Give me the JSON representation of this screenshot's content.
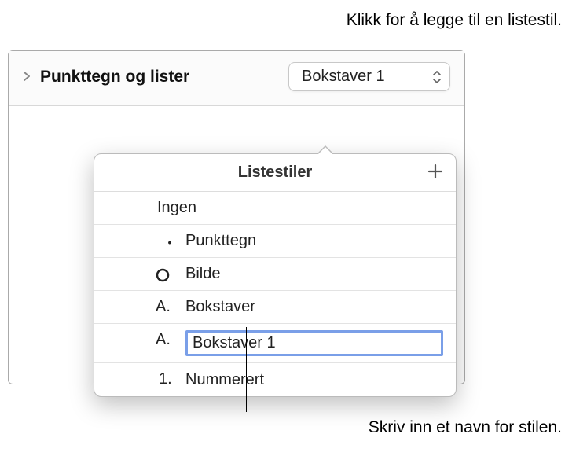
{
  "callouts": {
    "top": "Klikk for å legge til en listestil.",
    "bottom": "Skriv inn et navn for stilen."
  },
  "panel": {
    "title": "Punkttegn og lister",
    "dropdown_value": "Bokstaver 1"
  },
  "popover": {
    "title": "Listestiler",
    "add_icon_label": "+",
    "items": {
      "none": {
        "marker": "",
        "label": "Ingen"
      },
      "bullet": {
        "marker": "•",
        "label": "Punkttegn"
      },
      "image": {
        "marker": "circle",
        "label": "Bilde"
      },
      "letter": {
        "marker": "A.",
        "label": "Bokstaver"
      },
      "letter_editing": {
        "marker": "A.",
        "value": "Bokstaver 1"
      },
      "numbered": {
        "marker": "1.",
        "label": "Nummerert"
      }
    }
  }
}
